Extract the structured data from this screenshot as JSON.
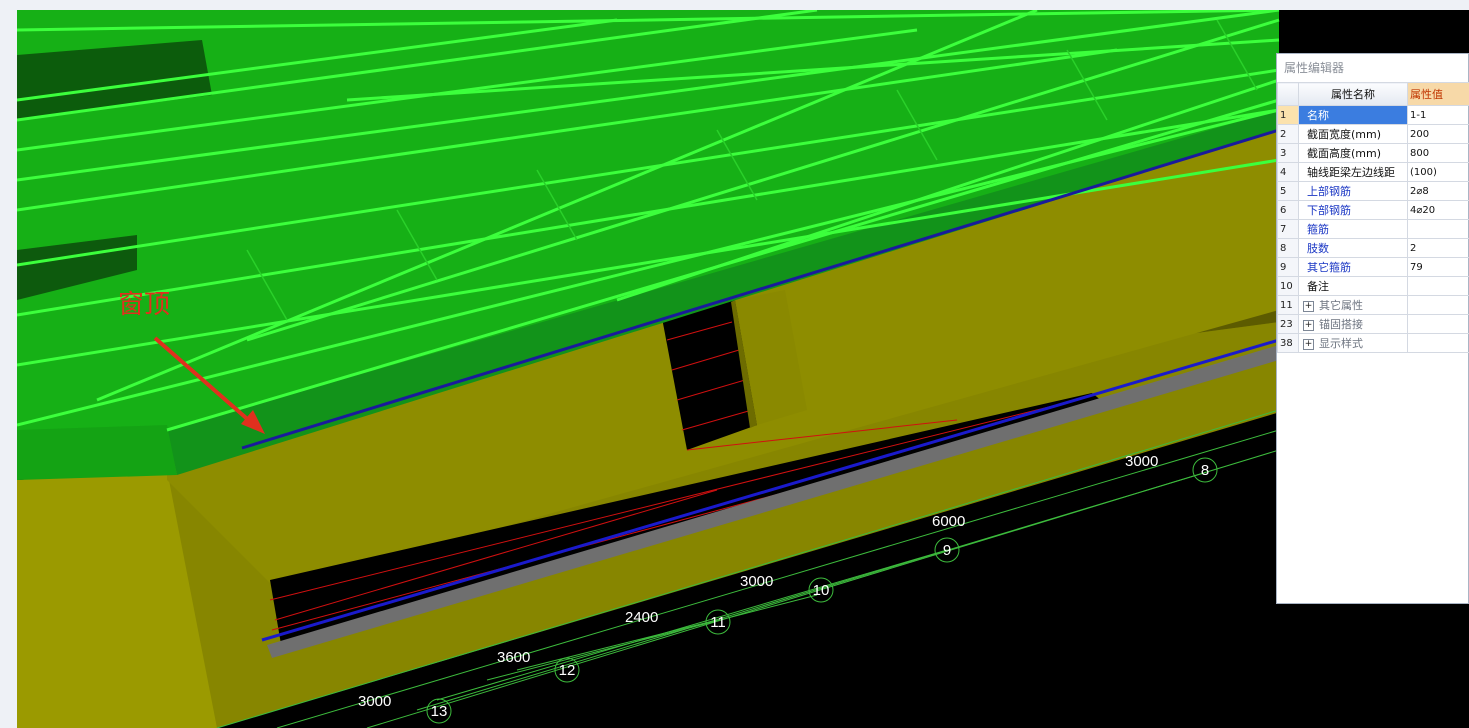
{
  "annotation": {
    "label": "窗顶"
  },
  "axes": [
    {
      "axis": "8",
      "span": "3000"
    },
    {
      "axis": "9",
      "span": "6000"
    },
    {
      "axis": "10",
      "span": "3000"
    },
    {
      "axis": "11",
      "span": "2400"
    },
    {
      "axis": "12",
      "span": "3600"
    },
    {
      "axis": "13",
      "span": "3000"
    }
  ],
  "property_editor": {
    "title": "属性编辑器",
    "header_name": "属性名称",
    "header_value": "属性值",
    "rows": [
      {
        "index": "1",
        "name": "名称",
        "value": "1-1",
        "style": "selected"
      },
      {
        "index": "2",
        "name": "截面宽度(mm)",
        "value": "200",
        "style": "normal"
      },
      {
        "index": "3",
        "name": "截面高度(mm)",
        "value": "800",
        "style": "normal"
      },
      {
        "index": "4",
        "name": "轴线距梁左边线距",
        "value": "(100)",
        "style": "normal"
      },
      {
        "index": "5",
        "name": "上部钢筋",
        "value": "2⌀8",
        "style": "blue"
      },
      {
        "index": "6",
        "name": "下部钢筋",
        "value": "4⌀20",
        "style": "blue"
      },
      {
        "index": "7",
        "name": "箍筋",
        "value": "",
        "style": "blue"
      },
      {
        "index": "8",
        "name": "肢数",
        "value": "2",
        "style": "blue"
      },
      {
        "index": "9",
        "name": "其它箍筋",
        "value": "79",
        "style": "blue"
      },
      {
        "index": "10",
        "name": "备注",
        "value": "",
        "style": "normal"
      },
      {
        "index": "11",
        "name": "其它属性",
        "value": "",
        "style": "group"
      },
      {
        "index": "23",
        "name": "锚固搭接",
        "value": "",
        "style": "group"
      },
      {
        "index": "38",
        "name": "显示样式",
        "value": "",
        "style": "group"
      }
    ]
  },
  "colors": {
    "slab_green": "#17b417",
    "grid_line_green": "#33ff33",
    "wall_yellow": "#9a9a00",
    "beam_gray": "#8c8c8c",
    "axis_green": "#3dbb3d",
    "annotation_red": "#e0301e"
  }
}
